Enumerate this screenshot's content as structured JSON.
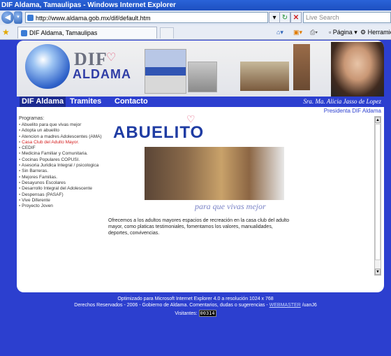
{
  "window": {
    "title": "DIF Aldama, Tamaulipas - Windows Internet Explorer"
  },
  "address": {
    "url": "http://www.aldama.gob.mx/dif/default.htm"
  },
  "search": {
    "placeholder": "Live Search"
  },
  "tab": {
    "label": "DIF Aldama, Tamaulipas"
  },
  "toolbar": {
    "page_label": "Página",
    "tools_label": "Herramie"
  },
  "banner": {
    "logo_top": "DIF",
    "logo_bottom": "ALDAMA"
  },
  "nav": {
    "items": [
      "DIF Aldama",
      "Tramites",
      "Contacto"
    ],
    "signature": "Sra. Ma. Alicia Jasso de Lopez",
    "role": "Presidenta DIF Aldama"
  },
  "programs": {
    "label": "Programas:",
    "items": [
      "Abuelito para que vivas mejor",
      "Adopta un abuelito",
      "Atencion a madres Adolescentes (AMA)",
      "Casa Club del Adulto Mayor.",
      "CEDIF",
      "Medicina Familiar y Comunitaria.",
      "Cocinas Populares COPUSI.",
      "Asesoria Juridica Integral / psicologica",
      "Sin Barreras.",
      "Mejores Familias.",
      "Desayunos Escolares",
      "Desarrollo Integral del Adolescente",
      "Despensas (PASAF)",
      "Vive Diferente",
      "Proyecto Joven"
    ],
    "active_index": 3
  },
  "content": {
    "heading": "ABUELITO",
    "subtitle": "para que vivas mejor",
    "description": "Ofrecemos a los adultos mayores espacios de recreación en la casa club del adulto mayor, como platicas testimoniales, fomentamos los valores, manualidades, deportes, convivencias."
  },
  "footer": {
    "line1": "Optimizado para Microsoft Internet Explorer 4.0 a resolución 1024 x 768",
    "line2_prefix": "Derechos Reservados - 2006 - Gobierno de Aldama. Comentarios, dudas o sugerencias - ",
    "webmaster_link": "WEBMASTER",
    "line2_suffix": " /uanJ6",
    "visitors_label": "Visitantes:",
    "visitors_count": "00314"
  },
  "colors": {
    "accent": "#2c3fcf",
    "active_program": "#d41c1c"
  }
}
